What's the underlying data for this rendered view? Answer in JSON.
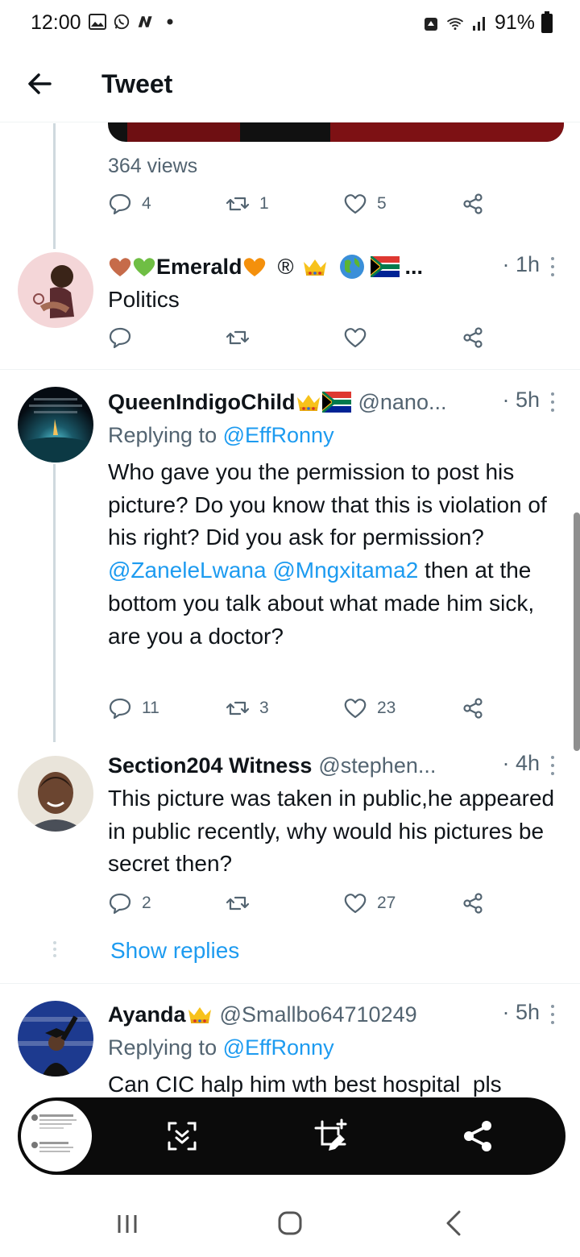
{
  "status_bar": {
    "time": "12:00",
    "battery": "91%"
  },
  "header": {
    "title": "Tweet"
  },
  "main_tweet": {
    "views": "364 views",
    "replies": "4",
    "retweets": "1",
    "likes": "5"
  },
  "tweets": [
    {
      "name": "Emerald",
      "time": "· 1h",
      "ellipsis": "...",
      "registered": "®",
      "text": "Politics",
      "replies": "",
      "retweets": "",
      "likes": ""
    },
    {
      "name": "QueenIndigoChild",
      "handle": "@nano...",
      "time": "· 5h",
      "replying_label": "Replying to ",
      "replying_to": "@EffRonny",
      "text_parts": [
        "Who gave you the permission to post his picture? Do you know that this is violation of his right? Did you ask for permission? ",
        "@ZaneleLwana",
        "@Mngxitama2",
        " then at the bottom you talk about what made him sick, are you a doctor?"
      ],
      "replies": "11",
      "retweets": "3",
      "likes": "23"
    },
    {
      "name": "Section204 Witness",
      "handle": "@stephen...",
      "time": "· 4h",
      "text": "This picture was taken in public,he appeared in public recently, why would his pictures be secret then?",
      "replies": "2",
      "retweets": "",
      "likes": "27"
    },
    {
      "name": "Ayanda",
      "handle": "@Smallbo64710249",
      "time": "· 5h",
      "replying_label": "Replying to ",
      "replying_to": "@EffRonny",
      "text": "Can CIC halp him wth best hospital  pls"
    }
  ],
  "show_replies": "Show replies",
  "colors": {
    "link": "#1d9bf0",
    "muted": "#536471",
    "text": "#0f1419"
  }
}
